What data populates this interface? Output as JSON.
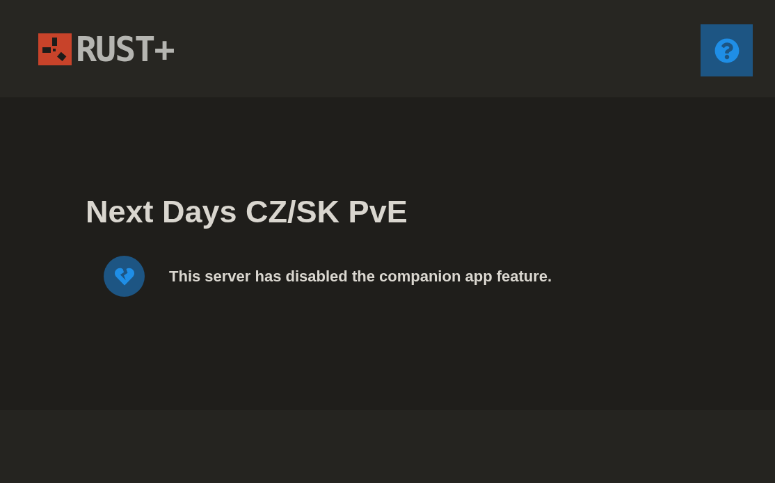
{
  "header": {
    "logo_text": "RUST+"
  },
  "server": {
    "name": "Next Days CZ/SK PvE",
    "message": "This server has disabled the companion app feature."
  }
}
